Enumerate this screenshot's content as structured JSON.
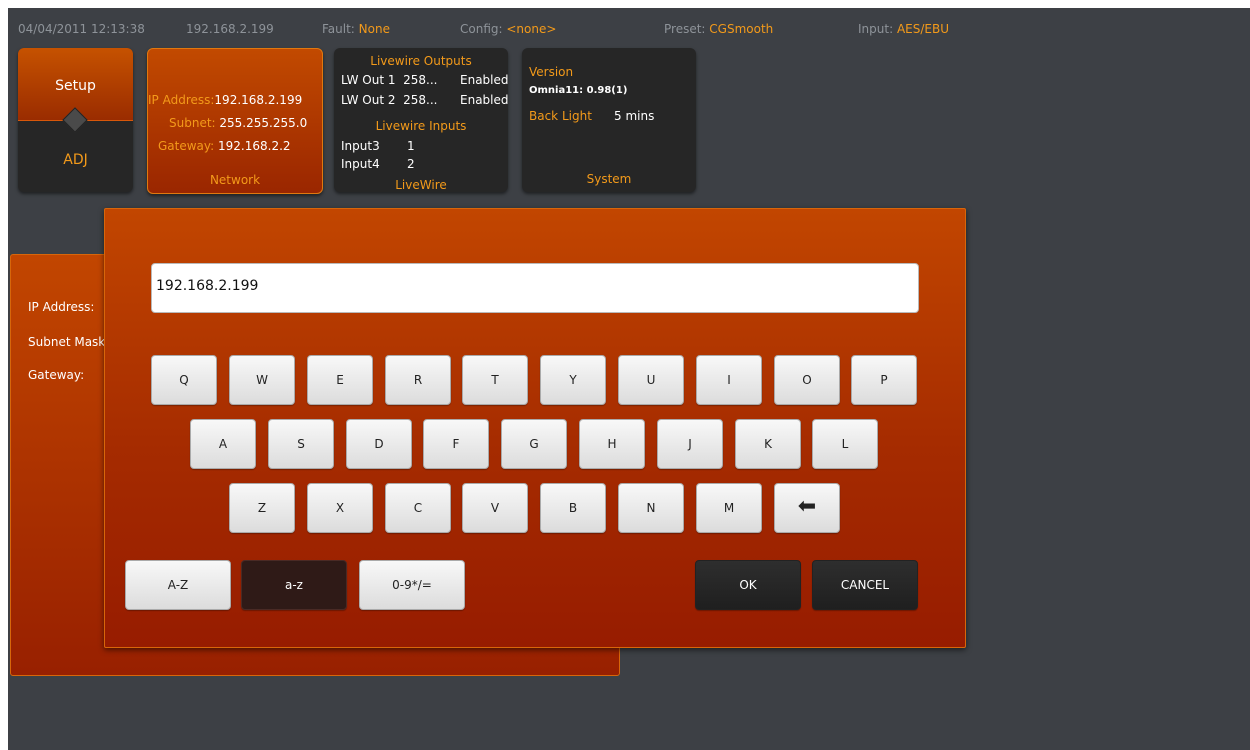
{
  "status": {
    "datetime": "04/04/2011 12:13:38",
    "ip": "192.168.2.199",
    "fault_label": "Fault:",
    "fault_value": "None",
    "config_label": "Config:",
    "config_value": "<none>",
    "preset_label": "Preset:",
    "preset_value": "CGSmooth",
    "input_label": "Input:",
    "input_value": "AES/EBU"
  },
  "tiles": {
    "setup": {
      "top_label": "Setup",
      "bottom_label": "ADJ"
    },
    "network": {
      "ip_label": "IP Address:",
      "ip_value": "192.168.2.199",
      "subnet_label": "Subnet:",
      "subnet_value": "255.255.255.0",
      "gateway_label": "Gateway:",
      "gateway_value": "192.168.2.2",
      "footer": "Network"
    },
    "livewire": {
      "outputs_title": "Livewire Outputs",
      "outputs": [
        {
          "name": "LW Out 1",
          "channel": "258...",
          "state": "Enabled"
        },
        {
          "name": "LW Out 2",
          "channel": "258...",
          "state": "Enabled"
        }
      ],
      "inputs_title": "Livewire Inputs",
      "inputs": [
        {
          "name": "Input3",
          "value": "1"
        },
        {
          "name": "Input4",
          "value": "2"
        }
      ],
      "footer": "LiveWire"
    },
    "system": {
      "version_label": "Version",
      "version_value": "Omnia11: 0.98(1)",
      "backlight_label": "Back Light",
      "backlight_value": "5 mins",
      "footer": "System"
    }
  },
  "back_dialog": {
    "ip_label": "IP Address:",
    "subnet_label": "Subnet Mask",
    "gateway_label": "Gateway:"
  },
  "keyboard": {
    "entry_value": "192.168.2.199",
    "rows": [
      [
        "Q",
        "W",
        "E",
        "R",
        "T",
        "Y",
        "U",
        "I",
        "O",
        "P"
      ],
      [
        "A",
        "S",
        "D",
        "F",
        "G",
        "H",
        "J",
        "K",
        "L"
      ],
      [
        "Z",
        "X",
        "C",
        "V",
        "B",
        "N",
        "M"
      ]
    ],
    "backspace_icon": "left-arrow-icon",
    "modes": [
      "A-Z",
      "a-z",
      "0-9*/="
    ],
    "active_mode": "a-z",
    "ok_label": "OK",
    "cancel_label": "CANCEL"
  }
}
